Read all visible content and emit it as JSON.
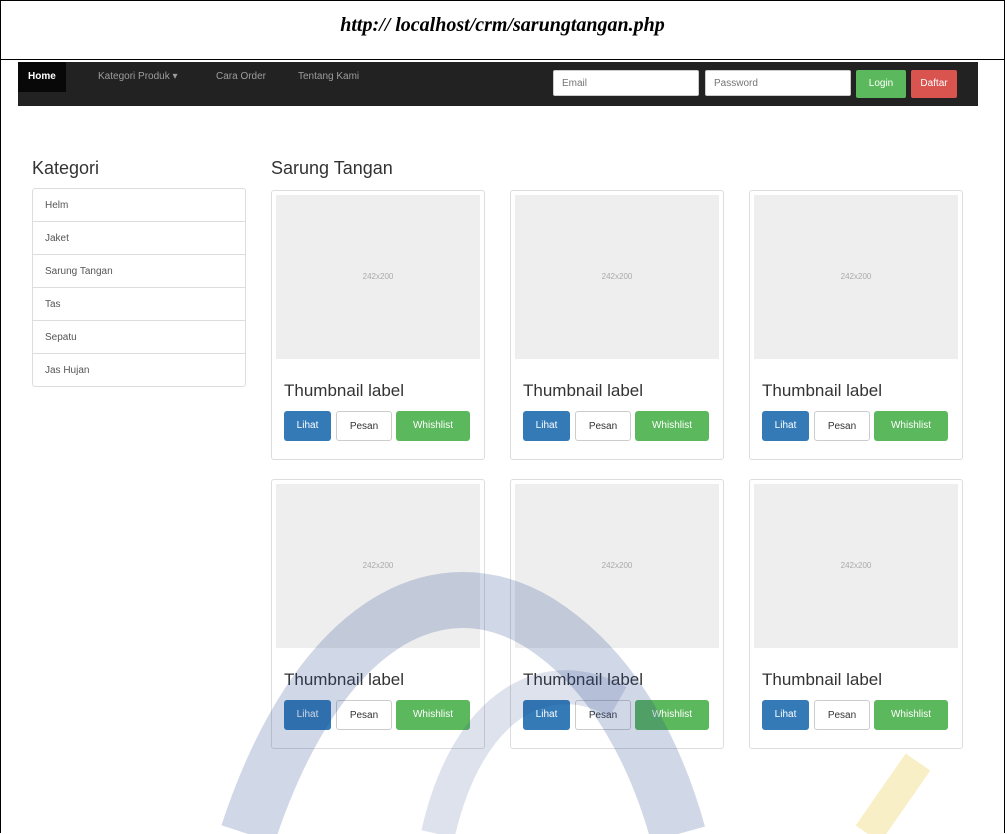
{
  "caption": {
    "url": "http:// localhost/crm/sarungtangan.php"
  },
  "navbar": {
    "items": [
      {
        "label": "Home",
        "active": true
      },
      {
        "label": "Kategori Produk ▾",
        "active": false
      },
      {
        "label": "Cara Order",
        "active": false
      },
      {
        "label": "Tentang Kami",
        "active": false
      }
    ],
    "email_placeholder": "Email",
    "password_placeholder": "Password",
    "login_label": "Login",
    "register_label": "Daftar"
  },
  "sidebar": {
    "title": "Kategori",
    "items": [
      "Helm",
      "Jaket",
      "Sarung Tangan",
      "Tas",
      "Sepatu",
      "Jas Hujan"
    ]
  },
  "main": {
    "title": "Sarung Tangan",
    "products": [
      {
        "image_text": "242x200",
        "label": "Thumbnail label",
        "btn_view": "Lihat",
        "btn_order": "Pesan",
        "btn_wish": "Whishlist"
      },
      {
        "image_text": "242x200",
        "label": "Thumbnail label",
        "btn_view": "Lihat",
        "btn_order": "Pesan",
        "btn_wish": "Whishlist"
      },
      {
        "image_text": "242x200",
        "label": "Thumbnail label",
        "btn_view": "Lihat",
        "btn_order": "Pesan",
        "btn_wish": "Whishlist"
      },
      {
        "image_text": "242x200",
        "label": "Thumbnail label",
        "btn_view": "Lihat",
        "btn_order": "Pesan",
        "btn_wish": "Whishlist"
      },
      {
        "image_text": "242x200",
        "label": "Thumbnail label",
        "btn_view": "Lihat",
        "btn_order": "Pesan",
        "btn_wish": "Whishlist"
      },
      {
        "image_text": "242x200",
        "label": "Thumbnail label",
        "btn_view": "Lihat",
        "btn_order": "Pesan",
        "btn_wish": "Whishlist"
      }
    ]
  },
  "colors": {
    "navbar": "#222222",
    "primary": "#337ab7",
    "success": "#5cb85c",
    "danger": "#d9534f"
  }
}
